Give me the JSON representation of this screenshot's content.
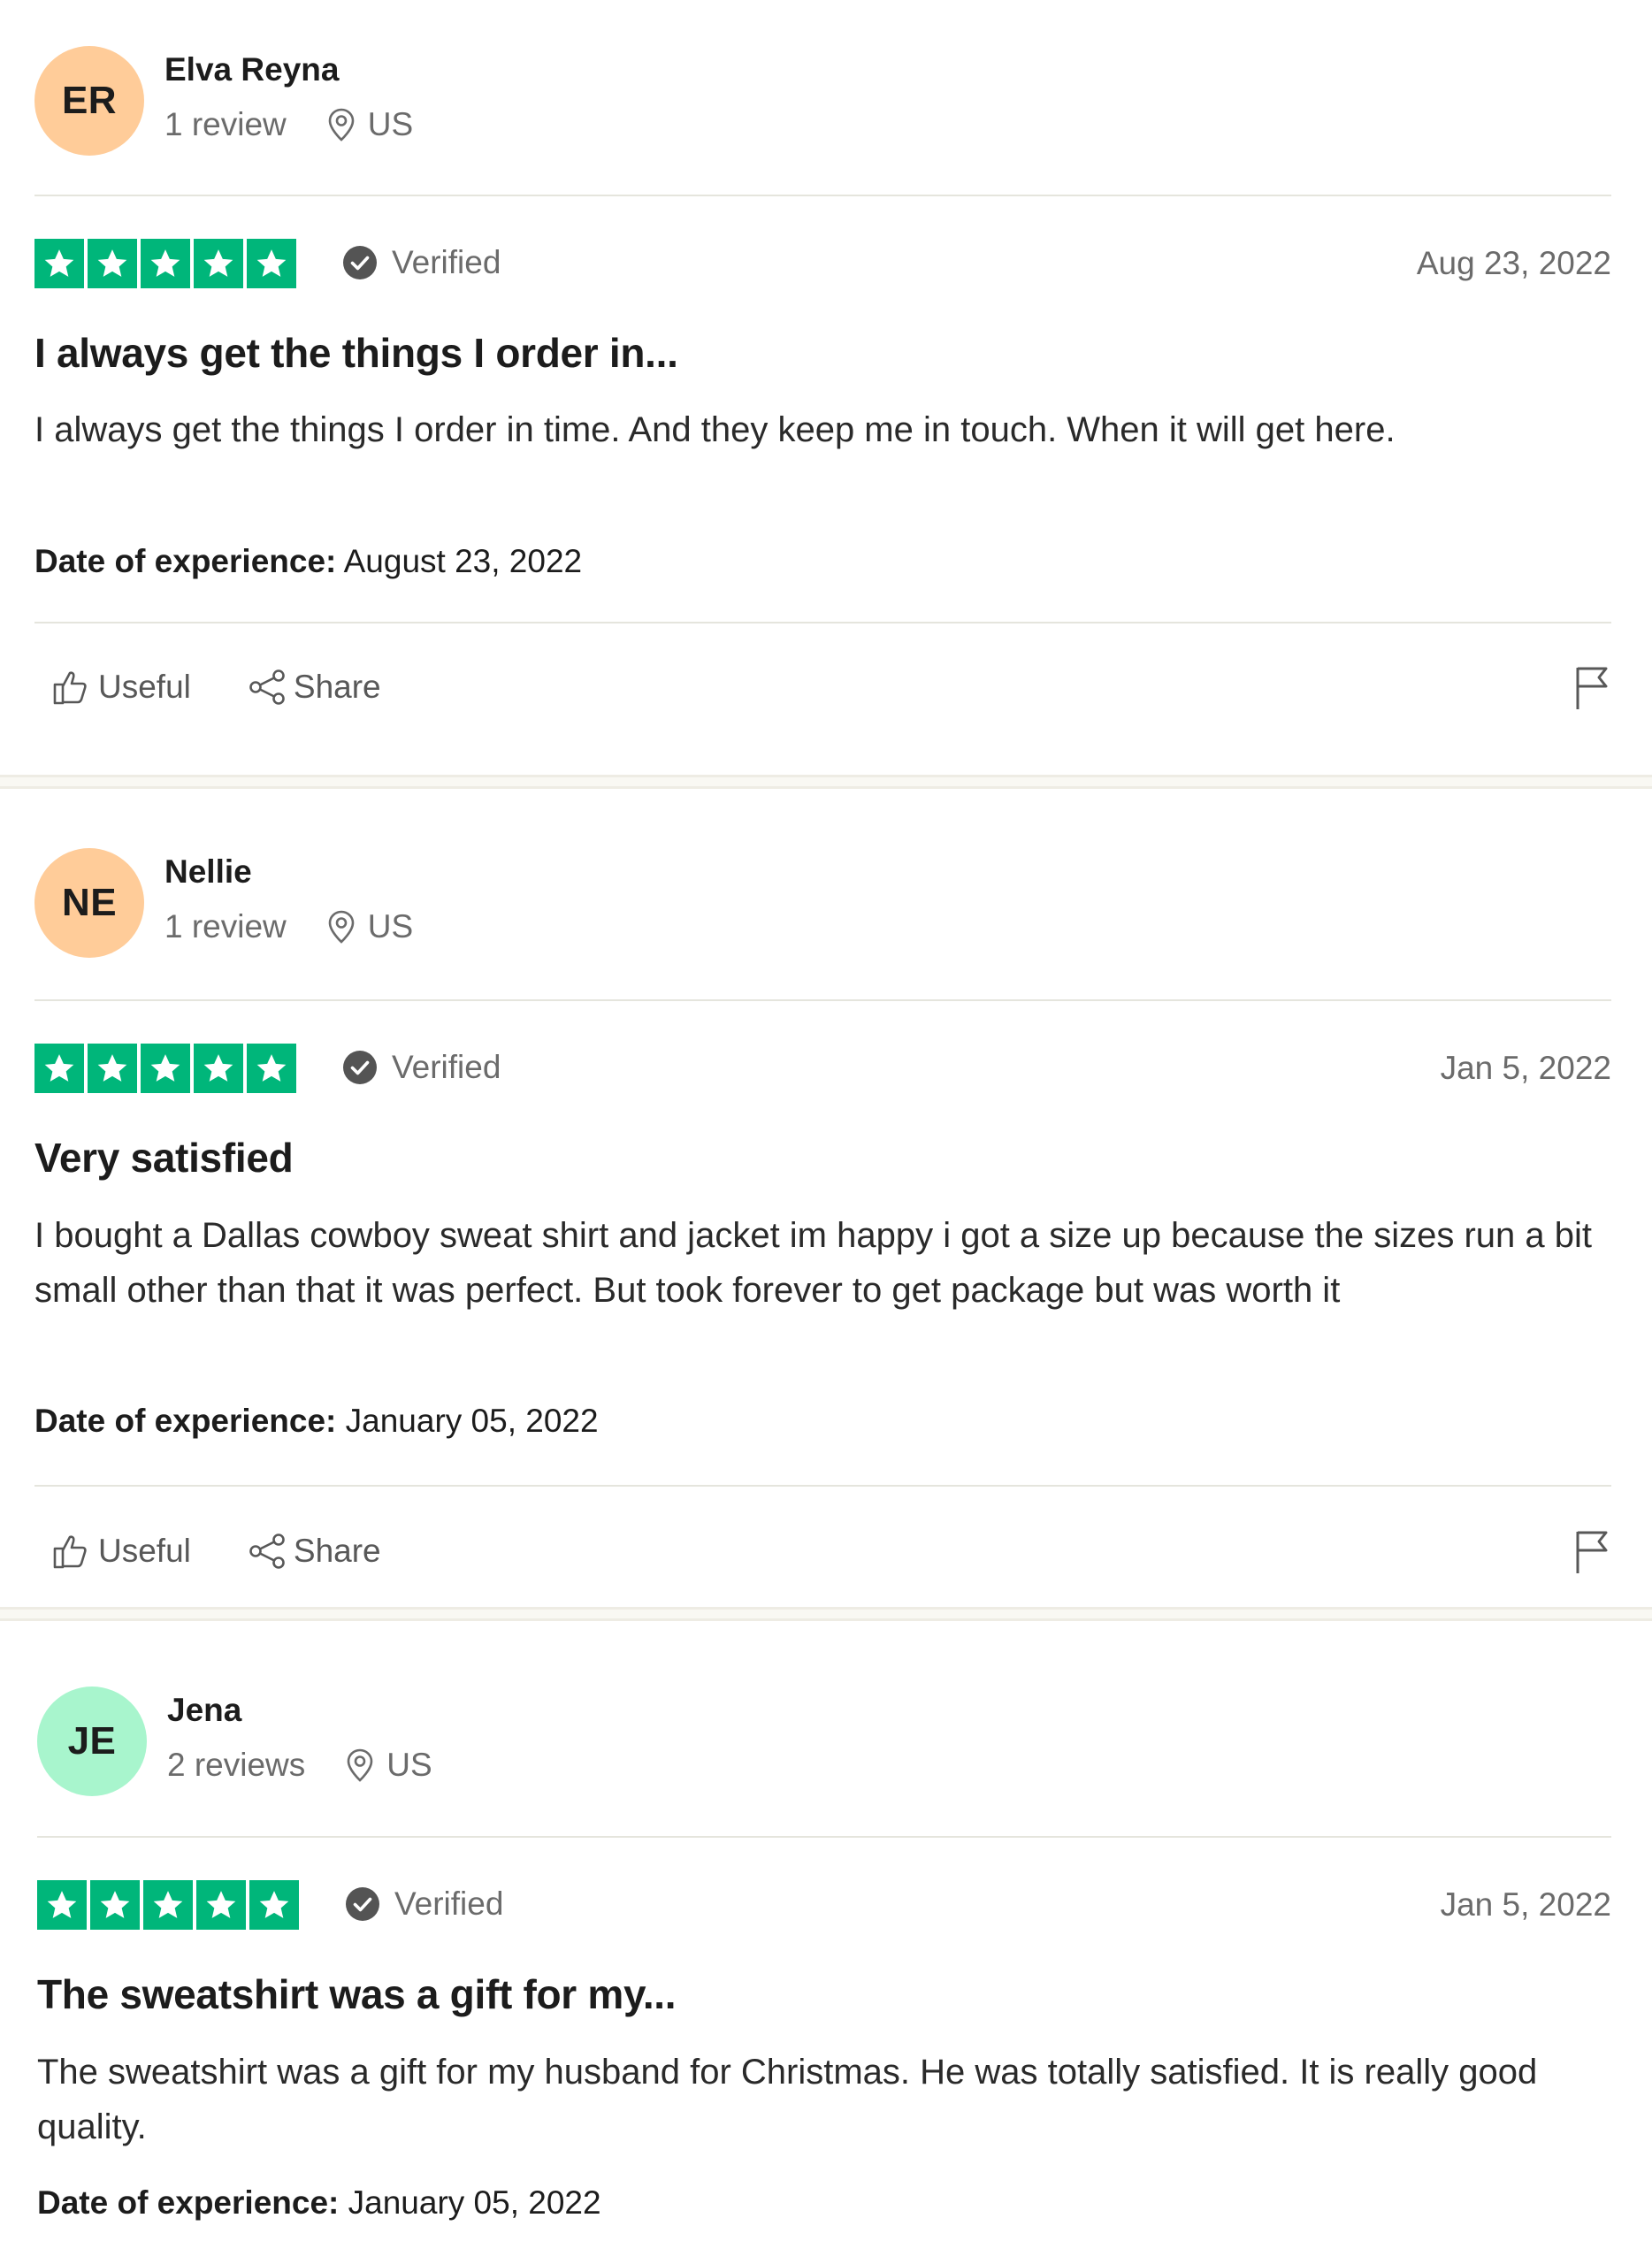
{
  "labels": {
    "verified": "Verified",
    "date_of_experience": "Date of experience:",
    "useful": "Useful",
    "share": "Share"
  },
  "colors": {
    "star_green": "#00b67a",
    "avatar_peach": "#ffcc99",
    "avatar_mint": "#a8f5cd"
  },
  "reviews": [
    {
      "initials": "ER",
      "avatar_color": "#ffcc99",
      "name": "Elva Reyna",
      "review_count": "1 review",
      "country": "US",
      "rating": 5,
      "date": "Aug 23, 2022",
      "title": "I always get the things I order in...",
      "body": "I always get the things I order in time. And they keep me in touch. When it will get here.",
      "experience_date": "August 23, 2022"
    },
    {
      "initials": "NE",
      "avatar_color": "#ffcc99",
      "name": "Nellie",
      "review_count": "1 review",
      "country": "US",
      "rating": 5,
      "date": "Jan 5, 2022",
      "title": "Very satisfied",
      "body": "I bought a Dallas cowboy sweat shirt and jacket im happy i got a size up because the sizes run a bit small other than that it was perfect. But took forever to get package but was worth it",
      "experience_date": "January 05, 2022"
    },
    {
      "initials": "JE",
      "avatar_color": "#a8f5cd",
      "name": "Jena",
      "review_count": "2 reviews",
      "country": "US",
      "rating": 5,
      "date": "Jan 5, 2022",
      "title": "The sweatshirt was a gift for my...",
      "body": "The sweatshirt was a gift for my husband for Christmas. He was totally satisfied. It is really good quality.",
      "experience_date": "January 05, 2022"
    }
  ]
}
